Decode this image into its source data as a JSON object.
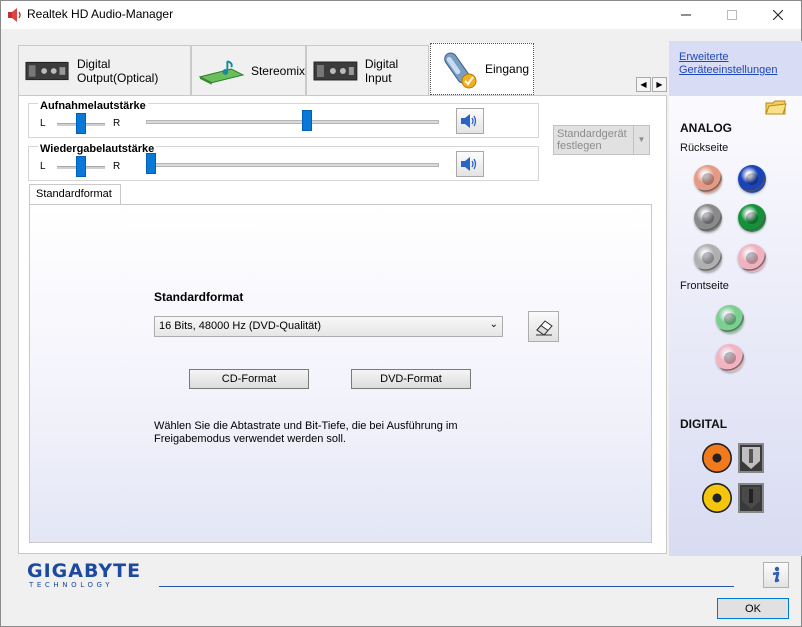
{
  "window": {
    "title": "Realtek HD Audio-Manager"
  },
  "tabs": [
    {
      "label": "Digital Output(Optical)"
    },
    {
      "label": "Stereomix"
    },
    {
      "label": "Digital Input"
    },
    {
      "label": "Eingang"
    }
  ],
  "recording_volume": {
    "title": "Aufnahmelautstärke",
    "left": "L",
    "right": "R",
    "balance": 0.5,
    "level": 0.55
  },
  "playback_volume": {
    "title": "Wiedergabelautstärke",
    "left": "L",
    "right": "R",
    "balance": 0.5,
    "level": 0.0
  },
  "default_device": {
    "line1": "Standardgerät",
    "line2": "festlegen"
  },
  "format_tab": {
    "label": "Standardformat"
  },
  "format": {
    "title": "Standardformat",
    "selected": "16 Bits, 48000 Hz (DVD-Qualität)",
    "cd_button": "CD-Format",
    "dvd_button": "DVD-Format",
    "description_1": "Wählen Sie die Abtastrate und Bit-Tiefe, die bei Ausführung im",
    "description_2": "Freigabemodus verwendet werden soll."
  },
  "sidebar": {
    "link_1": "Erweiterte",
    "link_2": "Geräteeinstellungen",
    "analog_heading": "ANALOG",
    "back_label": "Rückseite",
    "front_label": "Frontseite",
    "digital_heading": "DIGITAL",
    "back_jacks": [
      {
        "color": "#e59a86"
      },
      {
        "color": "#1a43b6"
      },
      {
        "color": "#8a8a8a"
      },
      {
        "color": "#15913a"
      },
      {
        "color": "#b0b0b0"
      },
      {
        "color": "#f0b2bf"
      }
    ],
    "front_jacks": [
      {
        "color": "#7ad08f"
      },
      {
        "color": "#f2b4c0"
      }
    ]
  },
  "brand": {
    "name": "GIGABYTE",
    "sub": "TECHNOLOGY"
  },
  "ok_button": "OK"
}
